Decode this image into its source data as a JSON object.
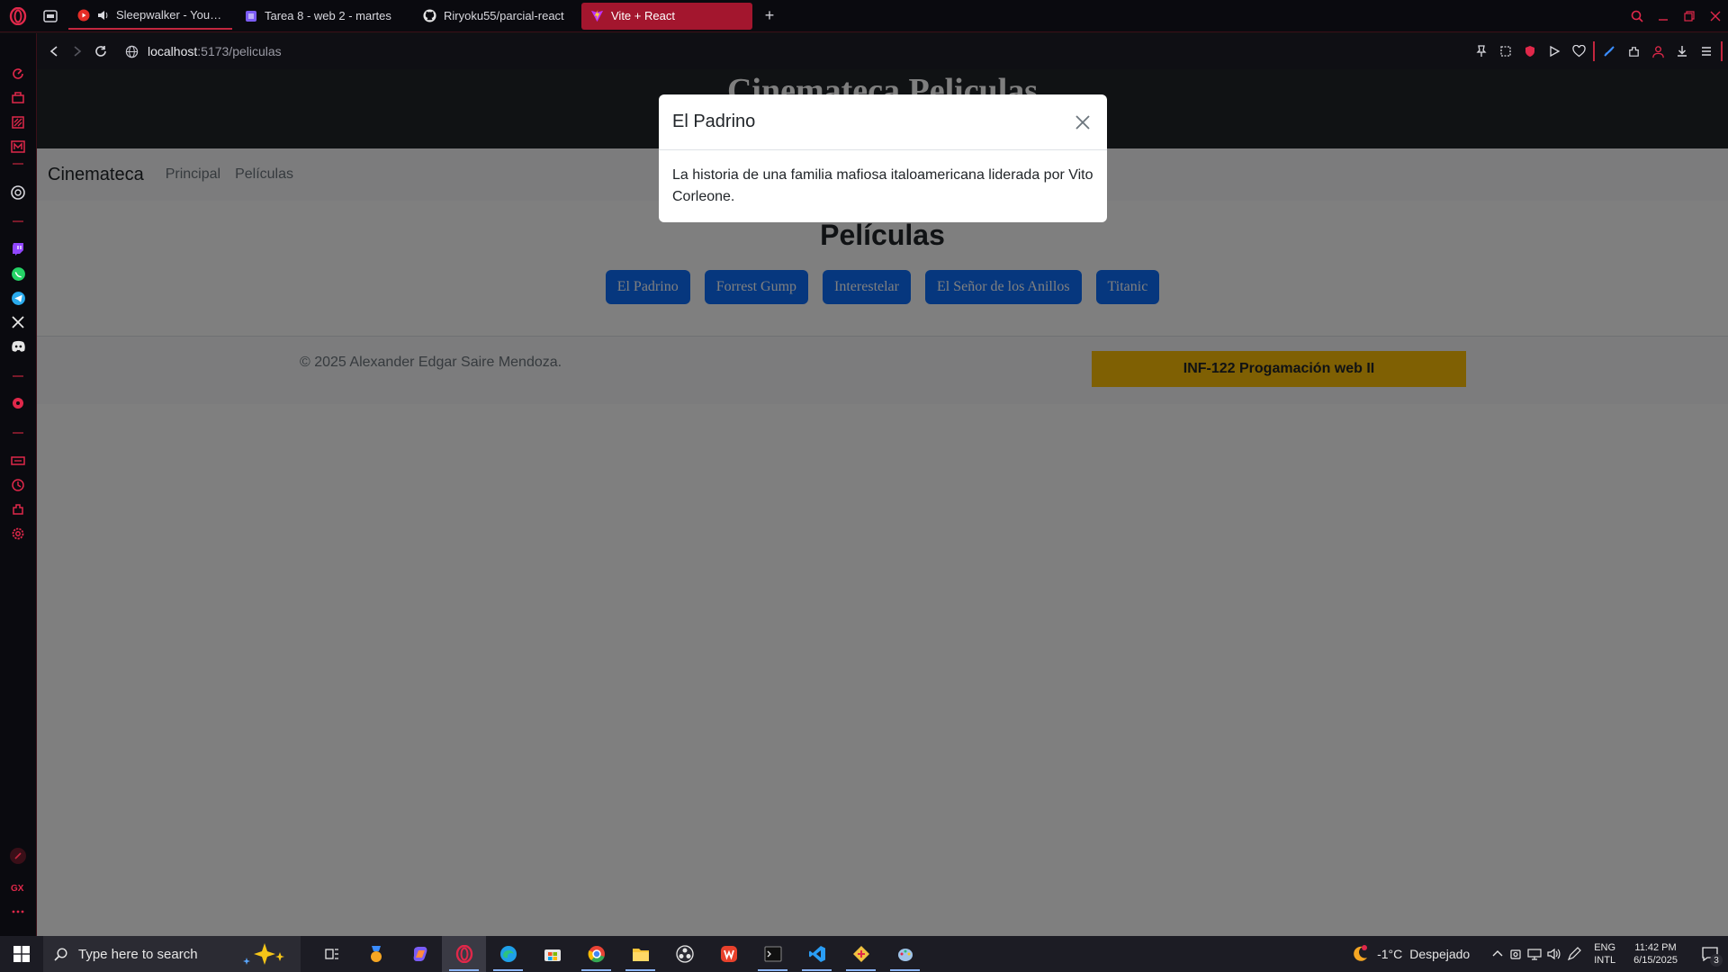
{
  "browser": {
    "tabs": [
      {
        "label": "Sleepwalker - YouTube",
        "icon": "youtube-icon"
      },
      {
        "label": "Tarea 8 - web 2 - martes",
        "icon": "document-icon"
      },
      {
        "label": "Riryoku55/parcial-react",
        "icon": "github-icon"
      },
      {
        "label": "Vite + React",
        "icon": "vite-icon",
        "active": true
      }
    ],
    "url_host": "localhost",
    "url_path": ":5173/peliculas",
    "accent_color": "#c2263e"
  },
  "page": {
    "header_title": "Cinemateca Peliculas",
    "nav": {
      "brand": "Cinemateca",
      "links": [
        "Principal",
        "Películas"
      ]
    },
    "section_title": "Películas",
    "movies": [
      "El Padrino",
      "Forrest Gump",
      "Interestelar",
      "El Señor de los Anillos",
      "Titanic"
    ],
    "footer": {
      "copyright": "© 2025 Alexander Edgar Saire Mendoza.",
      "badge": "INF-122 Progamación web II"
    },
    "colors": {
      "primary": "#0d6efd",
      "warning": "#ffc107",
      "dark": "#212529"
    }
  },
  "modal": {
    "title": "El Padrino",
    "body": "La historia de una familia mafiosa italoamericana liderada por Vito Corleone."
  },
  "taskbar": {
    "search_placeholder": "Type here to search",
    "weather_temp": "-1°C",
    "weather_text": "Despejado",
    "lang_line1": "ENG",
    "lang_line2": "INTL",
    "time": "11:42 PM",
    "date": "6/15/2025",
    "notification_count": "3"
  }
}
